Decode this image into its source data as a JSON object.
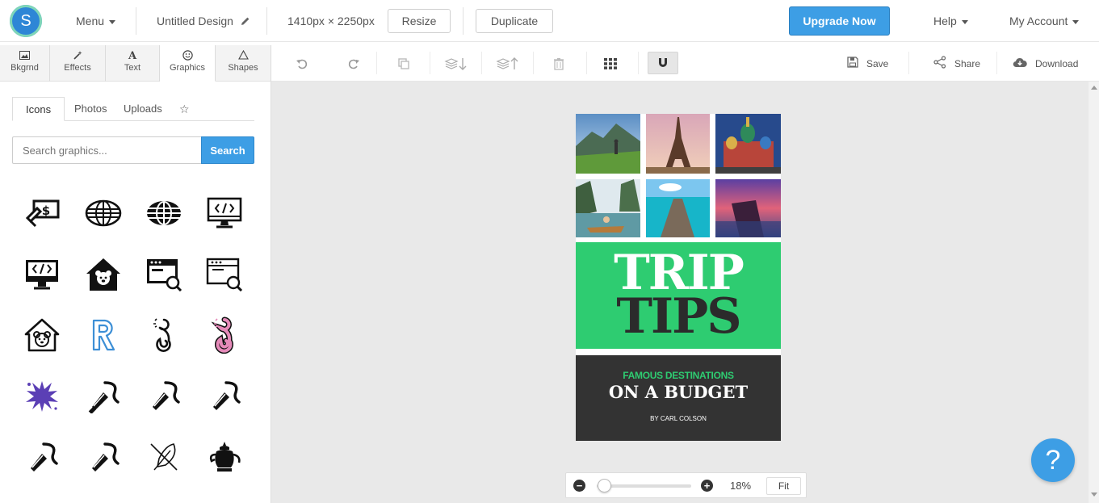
{
  "topbar": {
    "logo_letter": "S",
    "menu": "Menu",
    "design_name": "Untitled Design",
    "dimensions": "1410px × 2250px",
    "resize": "Resize",
    "duplicate": "Duplicate",
    "upgrade": "Upgrade Now",
    "help": "Help",
    "account": "My Account"
  },
  "tool_tabs": [
    {
      "label": "Bkgrnd",
      "icon": "image-icon"
    },
    {
      "label": "Effects",
      "icon": "magic-wand-icon"
    },
    {
      "label": "Text",
      "icon": "text-icon"
    },
    {
      "label": "Graphics",
      "icon": "smiley-icon"
    },
    {
      "label": "Shapes",
      "icon": "triangle-icon"
    }
  ],
  "toolbar": {
    "save": "Save",
    "share": "Share",
    "download": "Download"
  },
  "panel": {
    "subtabs": [
      "Icons",
      "Photos",
      "Uploads"
    ],
    "search_placeholder": "Search graphics...",
    "search_button": "Search"
  },
  "design": {
    "title_line1": "TRIP",
    "title_line2": "TIPS",
    "subtitle": "FAMOUS DESTINATIONS",
    "tagline": "ON A BUDGET",
    "author": "BY CARL COLSON"
  },
  "zoom": {
    "value": "18%",
    "fit": "Fit",
    "level": 0.05
  },
  "colors": {
    "accent": "#3d9ee5",
    "green": "#2ecc71",
    "dark": "#333333"
  }
}
